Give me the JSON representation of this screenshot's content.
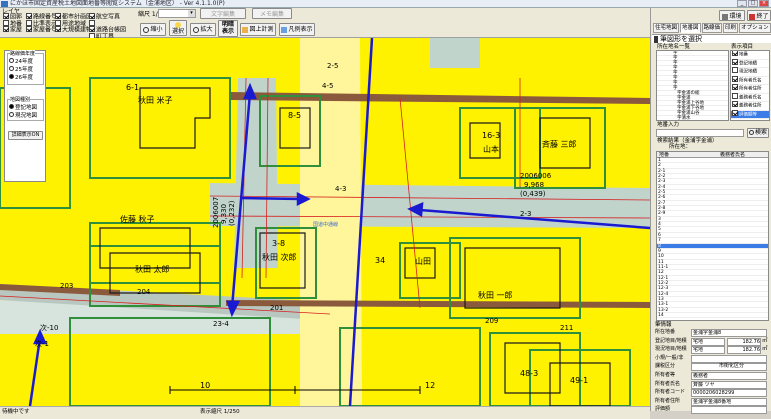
{
  "window": {
    "title": "にかほ市固定資産税土地図面地番等閲覧システム（金浦地区） - Ver 4.1.1.0(P)"
  },
  "toolbar": {
    "layer_legend_label": "レイヤ",
    "layers_col1": [
      "図郭",
      "地番",
      "家屋"
    ],
    "layers_col2": [
      "路線番号",
      "比準表示",
      "家屋番号"
    ],
    "layers_col3": [
      "都市計画図",
      "用途地域",
      "大規模建物"
    ],
    "layers_col4": [
      "航空写真",
      "",
      "道路台帳図",
      "町丁界"
    ],
    "scale_label": "縮尺 1/",
    "scale_value": "",
    "btn_edit": "文字編集",
    "btn_reset": "メモ編集",
    "btn_shrink": "縮小",
    "btn_select": "選択",
    "btn_enlarge": "拡大",
    "btn_brightness_1": "明暗",
    "btn_brightness_2": "表示",
    "btn_area": "図上計測",
    "btn_legend": "凡例表示"
  },
  "left_panel": {
    "year_group_label": "路線価年度",
    "years": [
      "24年度",
      "25年度",
      "26年度"
    ],
    "selected_year": "26年度",
    "map_type_label": "地図種別",
    "map_types": [
      "登記地図",
      "現況地図"
    ],
    "detail_button": "詳細表示ON"
  },
  "map": {
    "parcels": [
      "6-1",
      "8-5",
      "16-3",
      "3-8",
      "48-3",
      "49-1",
      "10",
      "12",
      "34"
    ],
    "owners": [
      "秋田 米子",
      "山本",
      "斉藤 三郎",
      "佐藤 秋子",
      "秋田 次郎",
      "秋田 太郎",
      "山田",
      "秋田 一郎"
    ],
    "road_numbers": [
      "4-3",
      "2-3",
      "203",
      "204",
      "201",
      "209",
      "211",
      "23-4",
      "2-5",
      "4-5",
      "次-10",
      "次-1"
    ],
    "road_value_label": "2006006",
    "road_value": "9,968",
    "road_value_sub": "(0,439)",
    "road_value_label_v": "2006007",
    "road_value_v": "9,330",
    "road_value_sub_v": "(0,232)",
    "road_name_label": "国道中通線",
    "coord_label": "(2-3)"
  },
  "statusbar": {
    "status_text": "待機中です",
    "scale_text": "表示縮尺 1/250"
  },
  "right_panel": {
    "top_buttons": [
      "環境",
      "終了"
    ],
    "tabs": [
      "住宅地図",
      "地番図",
      "路線価",
      "印刷",
      "オプション"
    ],
    "active_tab": "地番図",
    "search_header": "筆図形を選択",
    "address_label": "所在地名一覧",
    "display_items_label": "表示項目",
    "address_items": [
      "字",
      "字",
      "字",
      "字",
      "字",
      "字",
      "字",
      "字",
      "字金浦の総",
      "字金浦",
      "字金浦上谷地",
      "字金浦下谷地",
      "字金浦山谷",
      "字清水"
    ],
    "display_items": [
      "地番",
      "登記地積",
      "現況地積",
      "所有者氏名",
      "所有者住所",
      "義務者氏名",
      "義務者住所",
      "評価額等"
    ],
    "chiban_input_label": "地番入力",
    "chiban_value": "",
    "search_button": "検索",
    "result_label": "検索結果（金浦字金浦）",
    "result_sub": "所在地：",
    "result_columns": [
      "地番",
      "義務者氏名"
    ],
    "result_rows": [
      "1",
      "2",
      "2-1",
      "2-2",
      "2-3",
      "2-4",
      "2-5",
      "2-6",
      "2-7",
      "2-8",
      "2-9",
      "3",
      "4",
      "5",
      "6",
      "7",
      "8",
      "9",
      "10",
      "11",
      "11-1",
      "12",
      "12-1",
      "12-2",
      "12-3",
      "12-4",
      "13",
      "13-1",
      "13-2",
      "14"
    ],
    "selected_row": "8",
    "detail_header": "筆情報",
    "detail_fields": {
      "location_label": "所在地番",
      "location_value": "金浦字金浦8",
      "reg_label": "登記地目/地積",
      "reg_value": "宅地",
      "reg_area": "182.76",
      "cur_label": "現況地目/地積",
      "cur_value": "宅地",
      "cur_area": "182.76",
      "small_label": "小規/一般/非",
      "calc_label": "課税区分",
      "city_label": "市街化区分",
      "owner_type_label": "所有者等",
      "owner_type_value": "義務者",
      "name_label": "所有者氏名",
      "name_value": "斉藤 ツヤ",
      "code_label": "所有者コード",
      "code_value": "0000206028299",
      "addr_label": "所有者住所",
      "addr_value": "金浦字金浦8番地",
      "eval_label": "評価額"
    },
    "unit_sqm": "㎡"
  },
  "colors": {
    "accent": "#3b7ce6",
    "map_yellow": "#fff200",
    "road_gray": "#c0d4cc",
    "parcel_green": "#2f8f3a",
    "arrow_blue": "#1a1ad0"
  }
}
